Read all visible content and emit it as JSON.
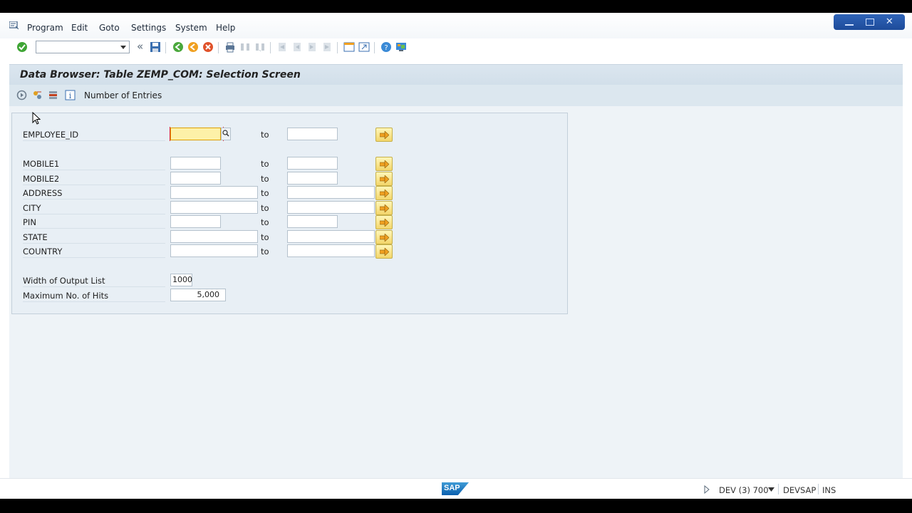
{
  "menu": {
    "items": [
      {
        "label": "Program",
        "u": "P"
      },
      {
        "label": "Edit",
        "u": "E"
      },
      {
        "label": "Goto",
        "u": "G"
      },
      {
        "label": "Settings",
        "u": "S"
      },
      {
        "label": "System",
        "u": "S"
      },
      {
        "label": "Help",
        "u": "H"
      }
    ]
  },
  "toolbar": {
    "command_field_value": "",
    "back_double_chevron": "«"
  },
  "screen": {
    "title": "Data Browser: Table ZEMP_COM: Selection Screen",
    "app_toolbar": {
      "number_of_entries_label": "Number of Entries"
    }
  },
  "selection": {
    "to_label": "to",
    "fields": [
      {
        "label": "EMPLOYEE_ID",
        "from": "",
        "to": ""
      },
      {
        "label": "MOBILE1",
        "from": "",
        "to": ""
      },
      {
        "label": "MOBILE2",
        "from": "",
        "to": ""
      },
      {
        "label": "ADDRESS",
        "from": "",
        "to": ""
      },
      {
        "label": "CITY",
        "from": "",
        "to": ""
      },
      {
        "label": "PIN",
        "from": "",
        "to": ""
      },
      {
        "label": "STATE",
        "from": "",
        "to": ""
      },
      {
        "label": "COUNTRY",
        "from": "",
        "to": ""
      }
    ],
    "width_of_output_list": {
      "label": "Width of Output List",
      "value": "1000"
    },
    "max_hits": {
      "label": "Maximum No. of Hits",
      "value": "5,000"
    }
  },
  "status": {
    "system": "DEV (3) 700",
    "server": "DEVSAP",
    "mode": "INS"
  },
  "colors": {
    "title_bg": "#dbe6ef",
    "selection_bg": "#e8eff5",
    "focus_field": "#fdf1a8",
    "window_controls": "#1d4b9a"
  }
}
